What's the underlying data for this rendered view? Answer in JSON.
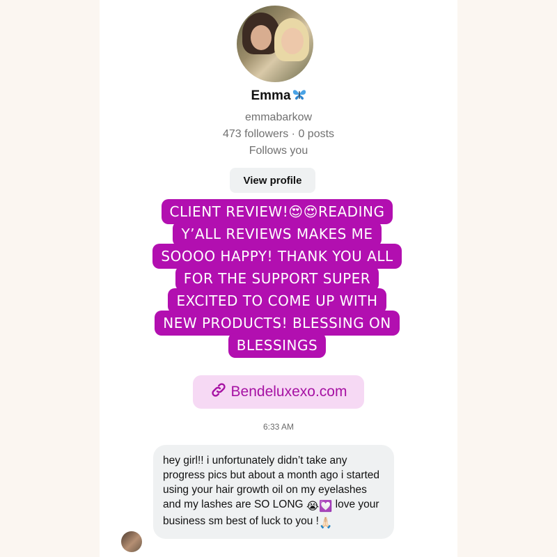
{
  "profile": {
    "display_name": "Emma",
    "name_emoji_icon": "butterfly-icon",
    "username": "emmabarkow",
    "stats": "473 followers · 0 posts",
    "follow_status": "Follows you",
    "view_profile_label": "View profile"
  },
  "story_banner": {
    "lines": [
      "CLIENT REVIEW!😍😍READING",
      "Y’ALL REVIEWS MAKES ME",
      "SOOOO HAPPY! THANK YOU ALL",
      "FOR THE SUPPORT SUPER",
      "EXCITED TO COME UP WITH",
      "NEW PRODUCTS! BLESSING ON",
      "BLESSINGS"
    ]
  },
  "link_sticker": {
    "icon": "link-icon",
    "label": "Bendeluxexo.com"
  },
  "message": {
    "timestamp": "6:33 AM",
    "text_part1": "hey girl!! i unfortunately didn’t take any progress pics but about a month ago i started using your hair growth oil on my eyelashes and my lashes are SO LONG ",
    "emoji1": "😭",
    "emoji2": "💟",
    "text_part2": " love your business sm best of luck to you !",
    "emoji3": "🙏🏻"
  },
  "colors": {
    "banner_bg": "#b20fb0",
    "link_sticker_bg": "#f6d9f4",
    "link_text": "#a611a3",
    "bubble_bg": "#eff1f2",
    "page_bg": "#fbf6f1"
  }
}
